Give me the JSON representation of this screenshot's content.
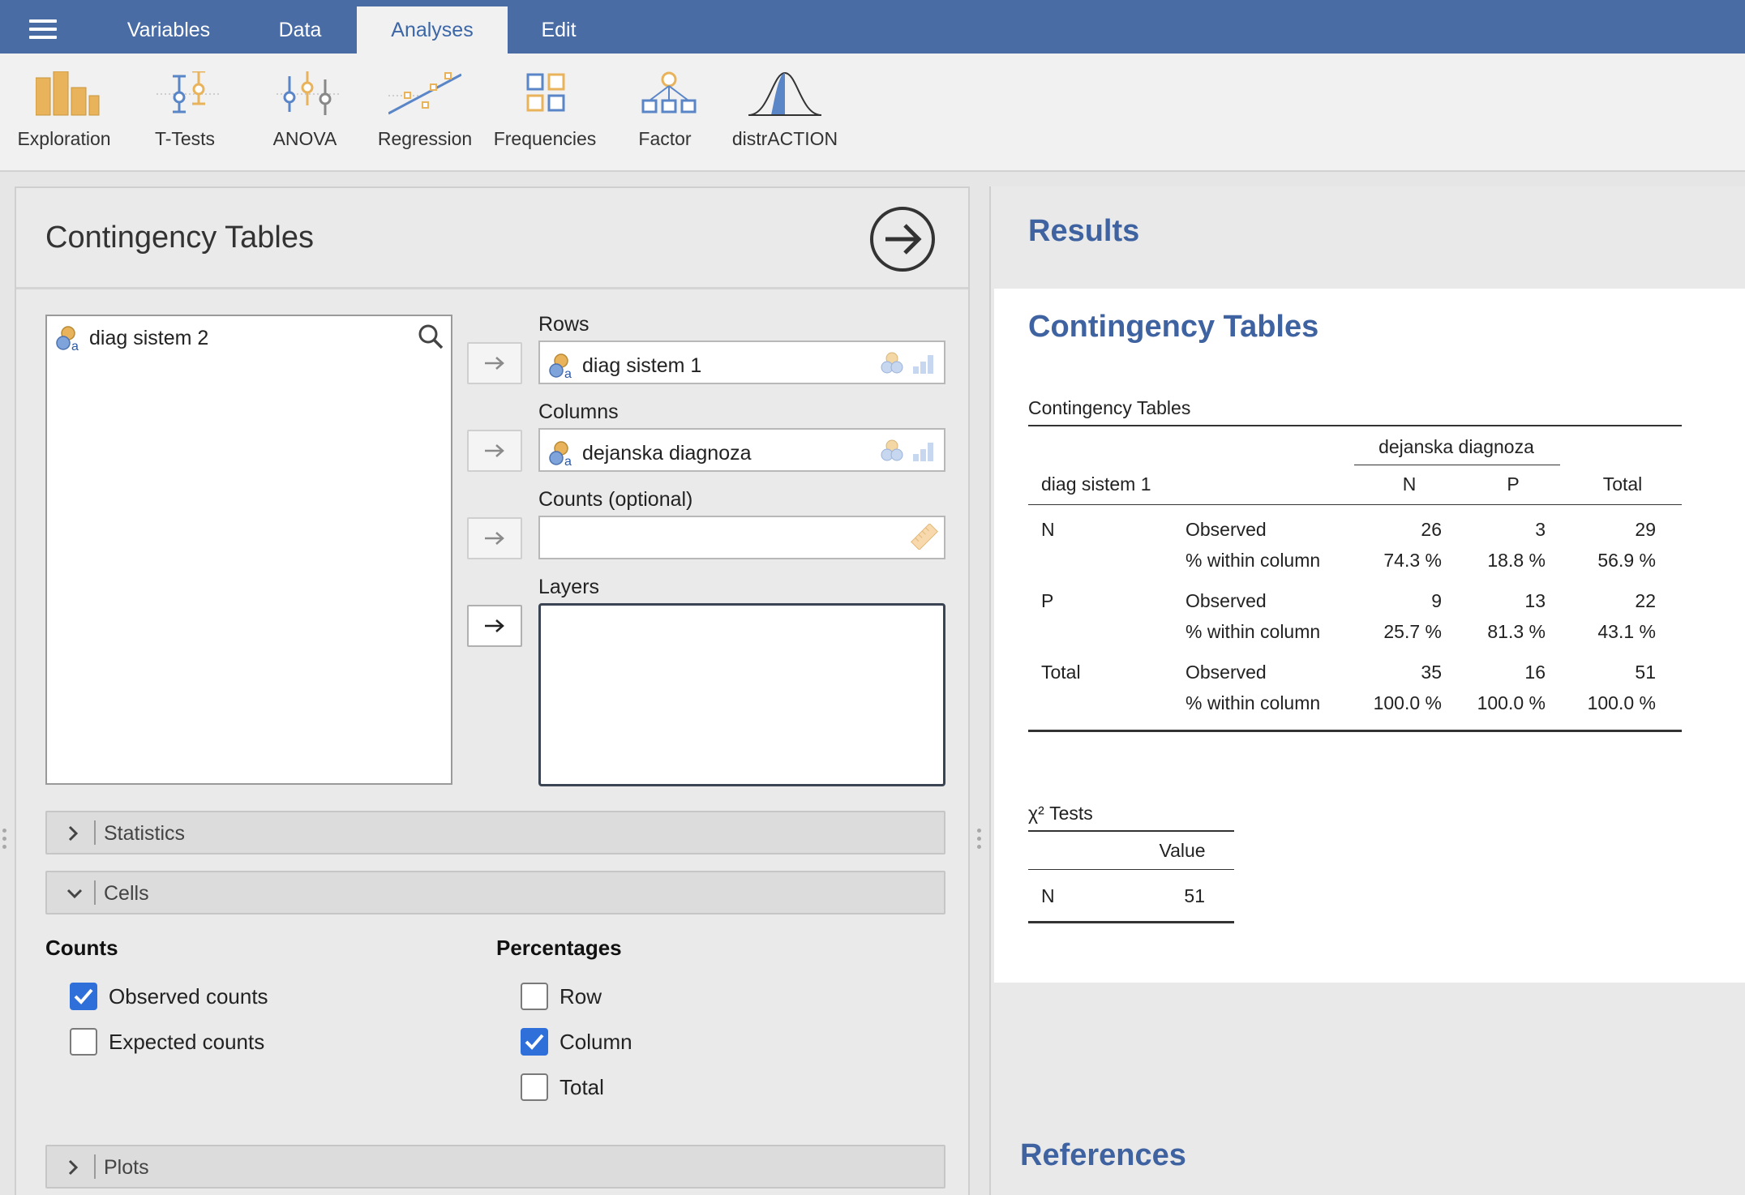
{
  "tabs": [
    "Variables",
    "Data",
    "Analyses",
    "Edit"
  ],
  "ribbon": {
    "exploration": "Exploration",
    "ttests": "T-Tests",
    "anova": "ANOVA",
    "regression": "Regression",
    "frequencies": "Frequencies",
    "factor": "Factor",
    "distraction": "distrACTION"
  },
  "options": {
    "title": "Contingency Tables",
    "available_variable": "diag sistem 2",
    "rows_label": "Rows",
    "rows_variable": "diag sistem 1",
    "columns_label": "Columns",
    "columns_variable": "dejanska diagnoza",
    "counts_label": "Counts (optional)",
    "layers_label": "Layers",
    "sections": {
      "statistics": "Statistics",
      "cells": "Cells",
      "plots": "Plots"
    },
    "cells": {
      "counts_title": "Counts",
      "observed": "Observed counts",
      "expected": "Expected counts",
      "percentages_title": "Percentages",
      "row": "Row",
      "column": "Column",
      "total": "Total"
    },
    "checked": {
      "observed": true,
      "expected": false,
      "row": false,
      "column": true,
      "total": false
    }
  },
  "results": {
    "title": "Results",
    "heading": "Contingency Tables",
    "table_caption": "Contingency Tables",
    "col_group": "dejanska diagnoza",
    "row_var": "diag sistem 1",
    "col_headers": [
      "N",
      "P",
      "Total"
    ],
    "rows": [
      {
        "label": "N",
        "obs_label": "Observed",
        "pct_label": "% within column",
        "obs": [
          "26",
          "3",
          "29"
        ],
        "pct": [
          "74.3 %",
          "18.8 %",
          "56.9 %"
        ]
      },
      {
        "label": "P",
        "obs_label": "Observed",
        "pct_label": "% within column",
        "obs": [
          "9",
          "13",
          "22"
        ],
        "pct": [
          "25.7 %",
          "81.3 %",
          "43.1 %"
        ]
      },
      {
        "label": "Total",
        "obs_label": "Observed",
        "pct_label": "% within column",
        "obs": [
          "35",
          "16",
          "51"
        ],
        "pct": [
          "100.0 %",
          "100.0 %",
          "100.0 %"
        ]
      }
    ],
    "chi_caption": "χ² Tests",
    "chi_value_header": "Value",
    "chi_n_label": "N",
    "chi_n_value": "51",
    "references_title": "References"
  }
}
